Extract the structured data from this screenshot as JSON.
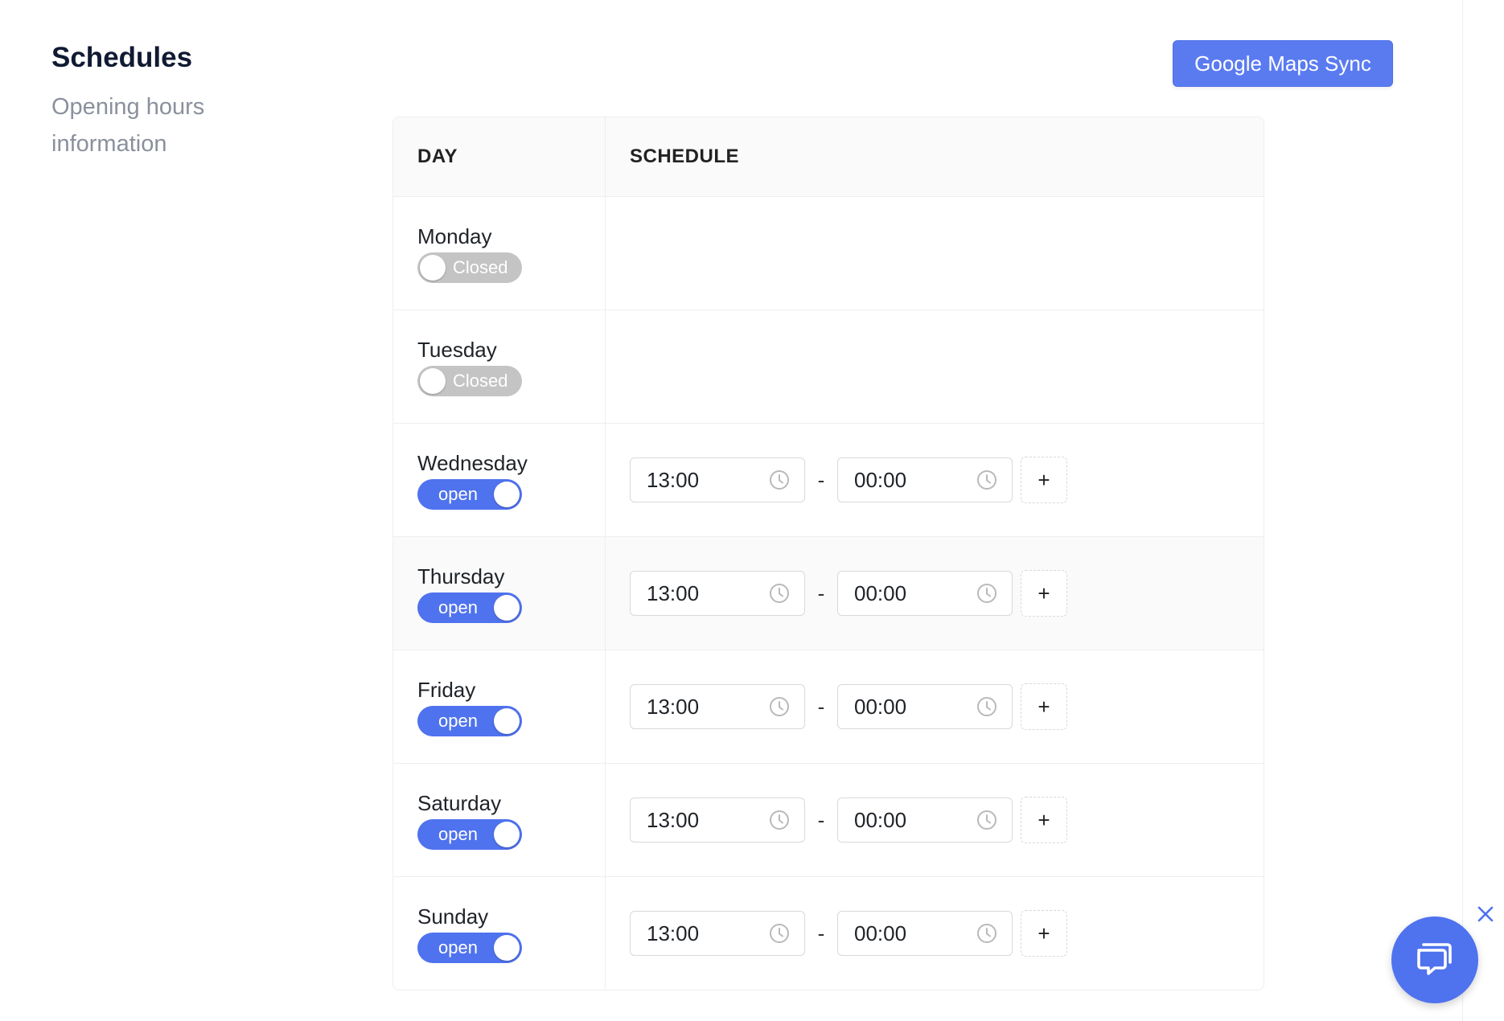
{
  "section": {
    "title": "Schedules",
    "description": "Opening hours information"
  },
  "sync_button": {
    "label": "Google Maps Sync"
  },
  "table": {
    "headers": {
      "day": "DAY",
      "schedule": "SCHEDULE"
    },
    "rows": [
      {
        "day": "Monday",
        "status": "Closed",
        "open": false
      },
      {
        "day": "Tuesday",
        "status": "Closed",
        "open": false
      },
      {
        "day": "Wednesday",
        "status": "open",
        "open": true,
        "from": "13:00",
        "to": "00:00"
      },
      {
        "day": "Thursday",
        "status": "open",
        "open": true,
        "from": "13:00",
        "to": "00:00"
      },
      {
        "day": "Friday",
        "status": "open",
        "open": true,
        "from": "13:00",
        "to": "00:00"
      },
      {
        "day": "Saturday",
        "status": "open",
        "open": true,
        "from": "13:00",
        "to": "00:00"
      },
      {
        "day": "Sunday",
        "status": "open",
        "open": true,
        "from": "13:00",
        "to": "00:00"
      }
    ],
    "separator": "-",
    "add_label": "+"
  },
  "colors": {
    "accent": "#4f72ee",
    "toggle_off": "#c4c4c4",
    "title": "#111a33",
    "muted": "#8a909c"
  },
  "icons": {
    "time": "clock-icon",
    "close": "close-icon",
    "chat": "chat-icon"
  }
}
